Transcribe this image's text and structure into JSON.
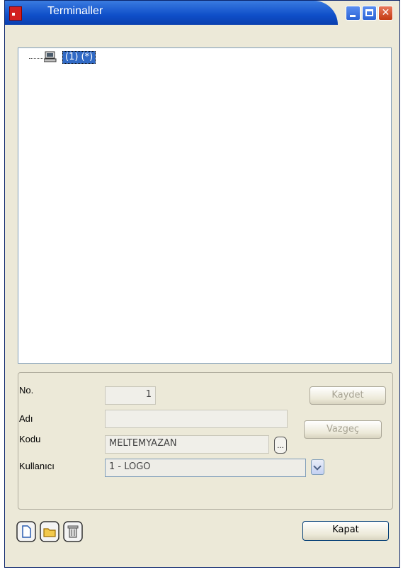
{
  "window": {
    "title": "Terminaller",
    "controls": {
      "minimize": "minimize",
      "maximize": "maximize",
      "close": "close"
    }
  },
  "tree": {
    "items": [
      {
        "label": "(1) (*)",
        "icon": "computer-icon",
        "selected": true
      }
    ]
  },
  "form": {
    "no_label": "No.",
    "no_value": "1",
    "adi_label": "Adı",
    "adi_value": "",
    "kodu_label": "Kodu",
    "kodu_value": "MELTEMYAZAN",
    "kodu_lookup": "...",
    "kullanici_label": "Kullanıcı",
    "kullanici_value": "1 - LOGO"
  },
  "buttons": {
    "kaydet": "Kaydet",
    "vazgec": "Vazgeç",
    "kapat": "Kapat"
  },
  "toolbar": {
    "icons": [
      "new-document-icon",
      "open-folder-icon",
      "delete-bin-icon"
    ]
  }
}
